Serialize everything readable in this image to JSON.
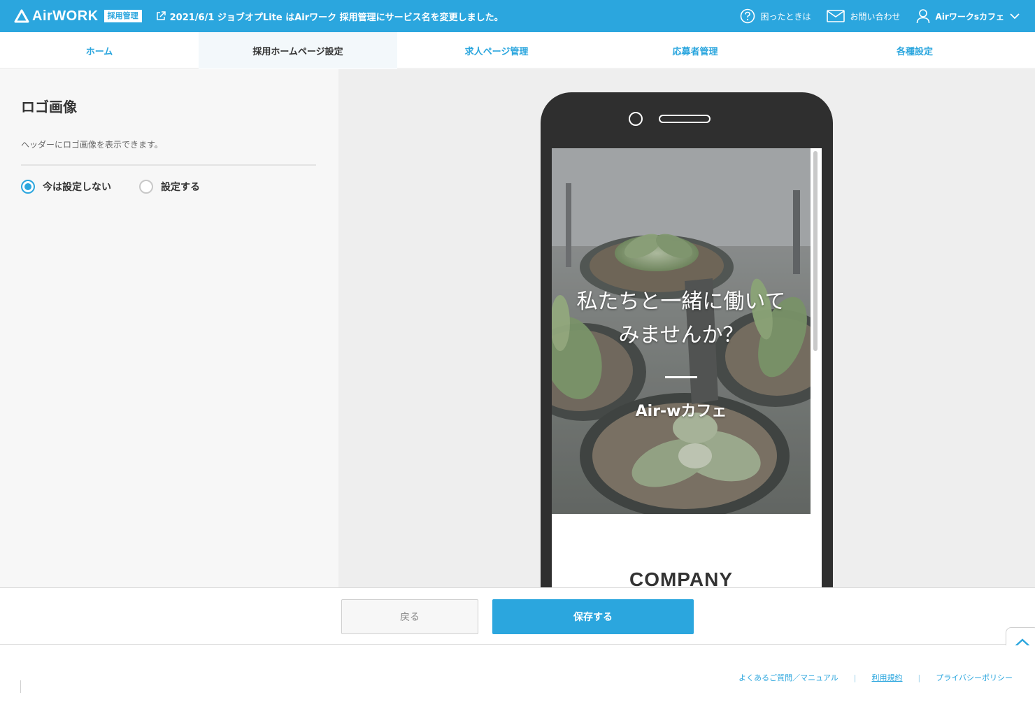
{
  "header": {
    "logo_text": "AirWORK",
    "logo_badge": "採用管理",
    "notice": "2021/6/1 ジョブオプLite はAirワーク 採用管理にサービス名を変更しました。",
    "help_label": "困ったときは",
    "contact_label": "お問い合わせ",
    "user_label": "Airワークsカフェ",
    "bg_color": "#2ba6de"
  },
  "nav": {
    "tabs": [
      {
        "label": "ホーム",
        "active": false
      },
      {
        "label": "採用ホームページ設定",
        "active": true
      },
      {
        "label": "求人ページ管理",
        "active": false
      },
      {
        "label": "応募者管理",
        "active": false
      },
      {
        "label": "各種設定",
        "active": false
      }
    ]
  },
  "settings": {
    "title": "ロゴ画像",
    "description": "ヘッダーにロゴ画像を表示できます。",
    "options": [
      {
        "label": "今は設定しない",
        "checked": true
      },
      {
        "label": "設定する",
        "checked": false
      }
    ]
  },
  "preview": {
    "hero_line1": "私たちと一緒に働いて",
    "hero_line2": "みませんか？",
    "company_name": "Air-wカフェ",
    "section_heading": "COMPANY"
  },
  "actions": {
    "back_label": "戻る",
    "save_label": "保存する"
  },
  "footer": {
    "links": [
      "よくあるご質問／マニュアル",
      "利用規約",
      "プライバシーポリシー"
    ],
    "separator": "|"
  },
  "icons": {
    "logo": "airwork-logo-icon",
    "notice": "external-link-icon",
    "help": "question-circle-icon",
    "contact": "envelope-icon",
    "user": "user-icon",
    "user_menu": "chevron-down-icon",
    "pagetop": "chevron-up-icon"
  }
}
